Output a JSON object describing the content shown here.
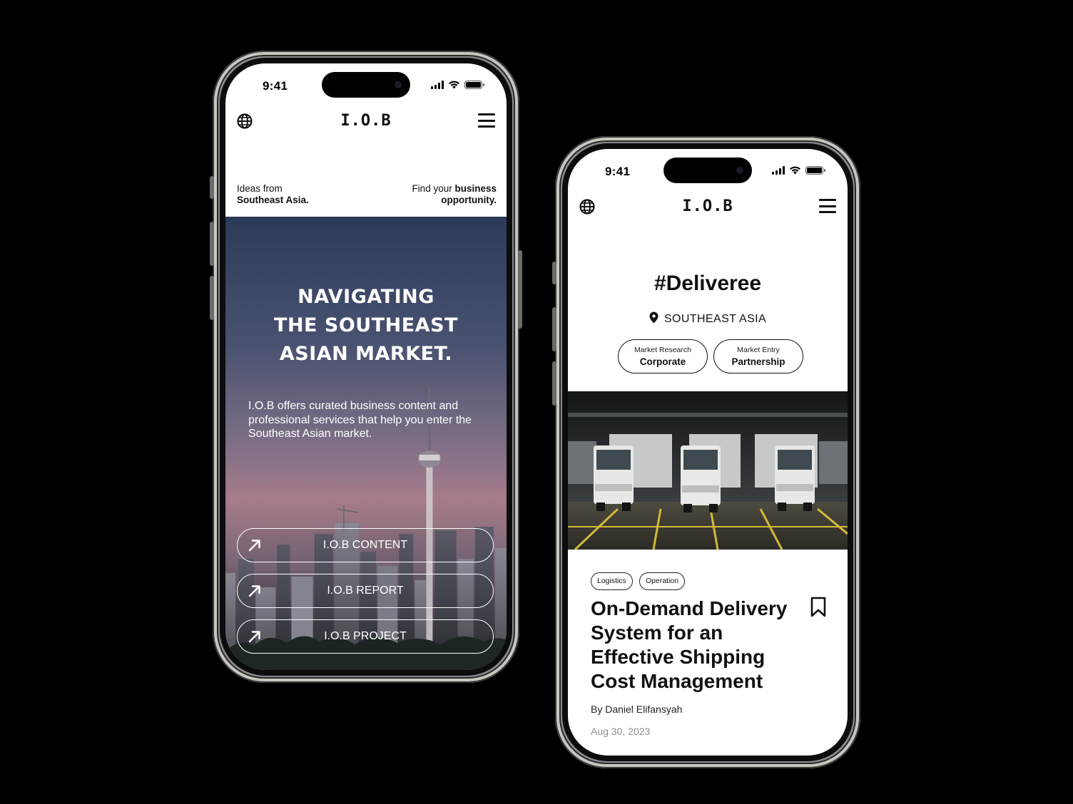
{
  "status_bar": {
    "time": "9:41"
  },
  "brand": {
    "logo": "I.O.B",
    "globe_icon": "globe-icon",
    "menu_icon": "hamburger-menu-icon"
  },
  "home": {
    "tagline_left_1": "Ideas from",
    "tagline_left_2": "Southeast Asia.",
    "tagline_right_1": "Find your ",
    "tagline_right_bold": "business",
    "tagline_right_2": "opportunity.",
    "hero_line_1": "NAVIGATING",
    "hero_line_2": "THE SOUTHEAST",
    "hero_line_3": "ASIAN MARKET.",
    "hero_description": "I.O.B offers curated business content and professional services that help you enter the Southeast Asian market.",
    "links": [
      {
        "label": "I.O.B CONTENT",
        "icon": "arrow-up-right-icon"
      },
      {
        "label": "I.O.B REPORT",
        "icon": "arrow-up-right-icon"
      },
      {
        "label": "I.O.B PROJECT",
        "icon": "arrow-up-right-icon"
      }
    ]
  },
  "company": {
    "hashtag": "#Deliveree",
    "location": "SOUTHEAST ASIA",
    "location_icon": "location-pin-icon",
    "services": [
      {
        "category": "Market Research",
        "type": "Corporate"
      },
      {
        "category": "Market Entry",
        "type": "Partnership"
      }
    ],
    "article": {
      "tags": [
        "Logistics",
        "Operation"
      ],
      "title": "On-Demand Delivery System for an Effective Shipping Cost Management",
      "author": "By Daniel Elifansyah",
      "date": "Aug 30, 2023",
      "bookmark_icon": "bookmark-icon"
    }
  },
  "colors": {
    "text": "#111111",
    "muted": "#8e8e8e",
    "background": "#000000",
    "screen": "#ffffff"
  }
}
